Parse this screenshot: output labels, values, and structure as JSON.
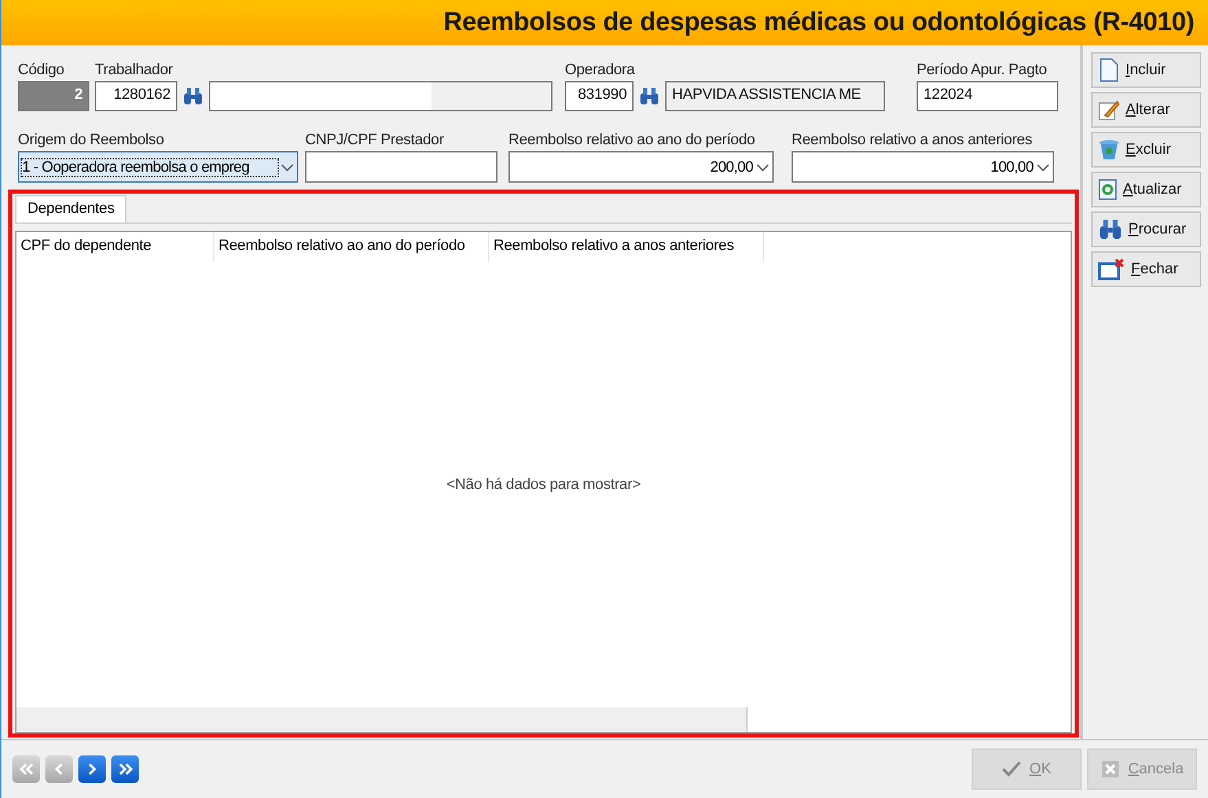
{
  "window": {
    "title": "Reembolsos de despesas médicas ou odontológicas (R-4010)"
  },
  "fields_row_1": [
    {
      "kind": "code",
      "label": "Código",
      "value": "2"
    },
    {
      "kind": "lookup",
      "label": "Trabalhador",
      "value": "1280162"
    },
    {
      "kind": "lookup",
      "label": "Operadora",
      "value": "831990",
      "name_value": "HAPVIDA ASSISTENCIA ME"
    },
    {
      "kind": "text",
      "label": "Período Apur. Pagto",
      "value": "122024"
    }
  ],
  "fields_row_2": [
    {
      "kind": "select",
      "label": "Origem do Reembolso",
      "value": "1 - Ooperadora reembolsa o empreg",
      "focused": true
    },
    {
      "kind": "text",
      "label": "CNPJ/CPF Prestador"
    },
    {
      "kind": "select",
      "label": "Reembolso relativo ao ano do período",
      "value": "200,00",
      "focused": false
    },
    {
      "kind": "select",
      "label": "Reembolso relativo a anos anteriores",
      "value": "100,00",
      "focused": false
    }
  ],
  "tabs": [
    {
      "label": "Dependentes",
      "selected": true
    }
  ],
  "table": {
    "columns": [
      "CPF do dependente",
      "Reembolso relativo ao ano do período",
      "Reembolso relativo a anos anteriores"
    ],
    "empty_message": "<Não há dados para mostrar>"
  },
  "toolbar": [
    {
      "kind": "new",
      "label": "Incluir"
    },
    {
      "kind": "edit",
      "label": "Alterar"
    },
    {
      "kind": "delete",
      "label": "Excluir"
    },
    {
      "kind": "refresh",
      "label": "Atualizar"
    },
    {
      "kind": "search",
      "label": "Procurar"
    },
    {
      "kind": "close",
      "label": "Fechar"
    }
  ],
  "navigation": [
    {
      "kind": "first",
      "disabled": true
    },
    {
      "kind": "previous",
      "disabled": true
    },
    {
      "kind": "next",
      "disabled": false
    },
    {
      "kind": "last",
      "disabled": false
    }
  ],
  "footer_buttons": [
    {
      "kind": "ok",
      "label": "OK",
      "disabled": true
    },
    {
      "kind": "cancel",
      "label": "Cancela",
      "disabled": true
    }
  ]
}
